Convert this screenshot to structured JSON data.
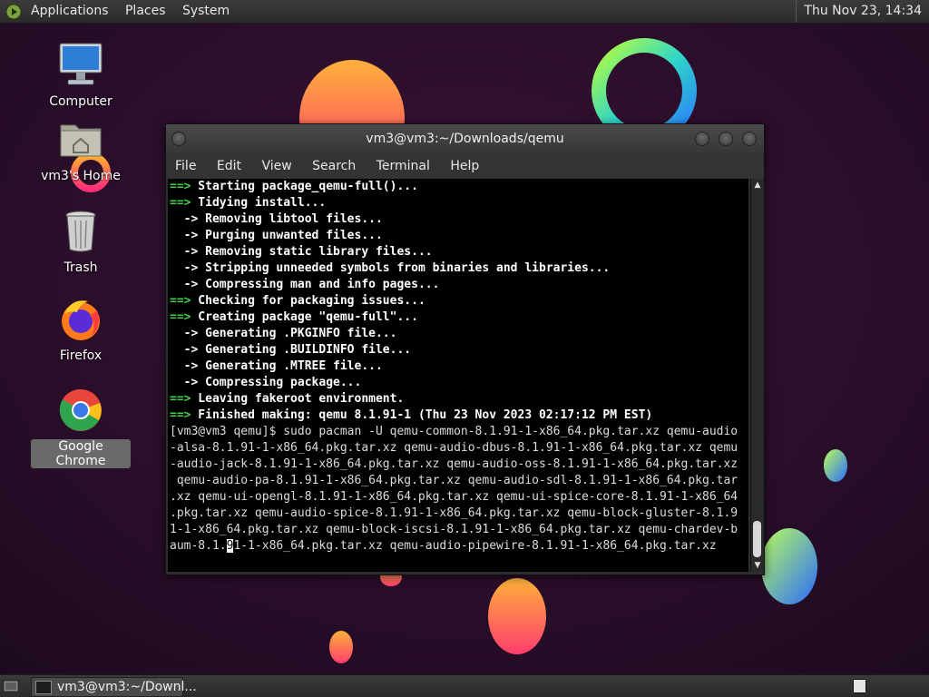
{
  "top_panel": {
    "menus": [
      "Applications",
      "Places",
      "System"
    ],
    "clock": "Thu Nov 23, 14:34"
  },
  "desktop_icons": [
    {
      "label": "Computer",
      "icon": "computer-icon"
    },
    {
      "label": "vm3's Home",
      "icon": "home-folder-icon"
    },
    {
      "label": "Trash",
      "icon": "trash-icon"
    },
    {
      "label": "Firefox",
      "icon": "firefox-icon"
    },
    {
      "label": "Google Chrome",
      "icon": "chrome-icon"
    }
  ],
  "terminal": {
    "title": "vm3@vm3:~/Downloads/qemu",
    "menu": [
      "File",
      "Edit",
      "View",
      "Search",
      "Terminal",
      "Help"
    ],
    "lines": [
      {
        "prefix": "==>",
        "text": " Starting package_qemu-full()...",
        "kind": "green"
      },
      {
        "prefix": "==>",
        "text": " Tidying install...",
        "kind": "green"
      },
      {
        "prefix": "  ->",
        "text": " Removing libtool files...",
        "kind": "sub"
      },
      {
        "prefix": "  ->",
        "text": " Purging unwanted files...",
        "kind": "sub"
      },
      {
        "prefix": "  ->",
        "text": " Removing static library files...",
        "kind": "sub"
      },
      {
        "prefix": "  ->",
        "text": " Stripping unneeded symbols from binaries and libraries...",
        "kind": "sub"
      },
      {
        "prefix": "  ->",
        "text": " Compressing man and info pages...",
        "kind": "sub"
      },
      {
        "prefix": "==>",
        "text": " Checking for packaging issues...",
        "kind": "green"
      },
      {
        "prefix": "==>",
        "text": " Creating package \"qemu-full\"...",
        "kind": "green"
      },
      {
        "prefix": "  ->",
        "text": " Generating .PKGINFO file...",
        "kind": "sub"
      },
      {
        "prefix": "  ->",
        "text": " Generating .BUILDINFO file...",
        "kind": "sub"
      },
      {
        "prefix": "  ->",
        "text": " Generating .MTREE file...",
        "kind": "sub"
      },
      {
        "prefix": "  ->",
        "text": " Compressing package...",
        "kind": "sub"
      },
      {
        "prefix": "==>",
        "text": " Leaving fakeroot environment.",
        "kind": "green"
      },
      {
        "prefix": "==>",
        "text": " Finished making: qemu 8.1.91-1 (Thu 23 Nov 2023 02:17:12 PM EST)",
        "kind": "green"
      },
      {
        "prefix": "",
        "text": "[vm3@vm3 qemu]$ sudo pacman -U qemu-common-8.1.91-1-x86_64.pkg.tar.xz qemu-audio",
        "kind": "plain"
      },
      {
        "prefix": "",
        "text": "-alsa-8.1.91-1-x86_64.pkg.tar.xz qemu-audio-dbus-8.1.91-1-x86_64.pkg.tar.xz qemu",
        "kind": "plain"
      },
      {
        "prefix": "",
        "text": "-audio-jack-8.1.91-1-x86_64.pkg.tar.xz qemu-audio-oss-8.1.91-1-x86_64.pkg.tar.xz",
        "kind": "plain"
      },
      {
        "prefix": "",
        "text": " qemu-audio-pa-8.1.91-1-x86_64.pkg.tar.xz qemu-audio-sdl-8.1.91-1-x86_64.pkg.tar",
        "kind": "plain"
      },
      {
        "prefix": "",
        "text": ".xz qemu-ui-opengl-8.1.91-1-x86_64.pkg.tar.xz qemu-ui-spice-core-8.1.91-1-x86_64",
        "kind": "plain"
      },
      {
        "prefix": "",
        "text": ".pkg.tar.xz qemu-audio-spice-8.1.91-1-x86_64.pkg.tar.xz qemu-block-gluster-8.1.9",
        "kind": "plain"
      },
      {
        "prefix": "",
        "text": "1-1-x86_64.pkg.tar.xz qemu-block-iscsi-8.1.91-1-x86_64.pkg.tar.xz qemu-chardev-b",
        "kind": "plain"
      },
      {
        "prefix": "",
        "text": "aum-8.1.91-1-x86_64.pkg.tar.xz qemu-audio-pipewire-8.1.91-1-x86_64.pkg.tar.xz",
        "kind": "cursorline"
      }
    ]
  },
  "taskbar": {
    "window_label": "vm3@vm3:~/Downl..."
  },
  "colors": {
    "prompt_green": "#3fd14a",
    "wallpaper_bg": "#2a0f2c"
  }
}
